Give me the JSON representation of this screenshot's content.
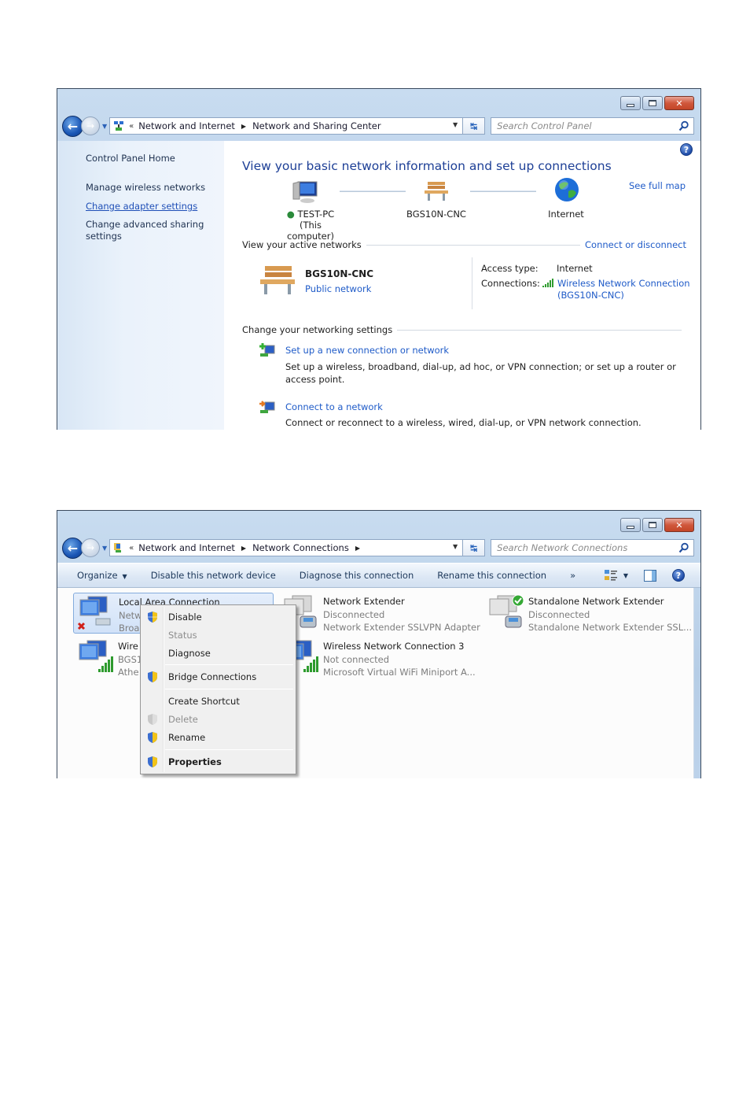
{
  "window1": {
    "breadcrumb": [
      "Network and Internet",
      "Network and Sharing Center"
    ],
    "search_placeholder": "Search Control Panel",
    "sidebar": {
      "home": "Control Panel Home",
      "items": [
        {
          "label": "Manage wireless networks",
          "link": false
        },
        {
          "label": "Change adapter settings",
          "link": true
        },
        {
          "label": "Change advanced sharing settings",
          "link": false
        }
      ]
    },
    "title": "View your basic network information and set up connections",
    "see_full_map": "See full map",
    "map": {
      "computer_name": "TEST-PC",
      "computer_sub": "(This computer)",
      "network": "BGS10N-CNC",
      "internet": "Internet"
    },
    "active_networks": {
      "heading": "View your active networks",
      "connect_link": "Connect or disconnect",
      "network_name": "BGS10N-CNC",
      "network_type": "Public network",
      "access_type_label": "Access type:",
      "access_type_value": "Internet",
      "connections_label": "Connections:",
      "connection_line1": "Wireless Network Connection",
      "connection_line2": "(BGS10N-CNC)"
    },
    "settings": {
      "heading": "Change your networking settings",
      "tasks": [
        {
          "title": "Set up a new connection or network",
          "desc": "Set up a wireless, broadband, dial-up, ad hoc, or VPN connection; or set up a router or access point."
        },
        {
          "title": "Connect to a network",
          "desc": "Connect or reconnect to a wireless, wired, dial-up, or VPN network connection."
        }
      ]
    }
  },
  "window2": {
    "breadcrumb": [
      "Network and Internet",
      "Network Connections"
    ],
    "search_placeholder": "Search Network Connections",
    "commands": [
      "Organize",
      "Disable this network device",
      "Diagnose this connection",
      "Rename this connection"
    ],
    "overflow": "»",
    "connections": [
      {
        "name": "Local Area Connection",
        "status": "Netw",
        "device": "Broa",
        "selected": true
      },
      {
        "name": "Wire",
        "status": "BGS1",
        "device": "Athe",
        "selected": false
      },
      {
        "name": "Network Extender",
        "status": "Disconnected",
        "device": "Network Extender SSLVPN Adapter",
        "selected": false
      },
      {
        "name": "Wireless Network Connection 3",
        "status": "Not connected",
        "device": "Microsoft Virtual WiFi Miniport A...",
        "selected": false
      },
      {
        "name": "Standalone Network Extender",
        "status": "Disconnected",
        "device": "Standalone Network Extender SSL...",
        "selected": false
      }
    ],
    "context_menu": [
      {
        "label": "Disable",
        "shield": true,
        "disabled": false,
        "bold": false
      },
      {
        "label": "Status",
        "shield": false,
        "disabled": true,
        "bold": false
      },
      {
        "label": "Diagnose",
        "shield": false,
        "disabled": false,
        "bold": false
      },
      {
        "label": "Bridge Connections",
        "shield": true,
        "disabled": false,
        "bold": false
      },
      {
        "label": "Create Shortcut",
        "shield": false,
        "disabled": false,
        "bold": false
      },
      {
        "label": "Delete",
        "shield": true,
        "disabled": true,
        "bold": false
      },
      {
        "label": "Rename",
        "shield": true,
        "disabled": false,
        "bold": false
      },
      {
        "label": "Properties",
        "shield": true,
        "disabled": false,
        "bold": true
      }
    ]
  },
  "colors": {
    "link": "#1f5bc8",
    "title": "#1d3f96",
    "signal_green": "#2e9b2e",
    "error_red": "#d0201a"
  }
}
